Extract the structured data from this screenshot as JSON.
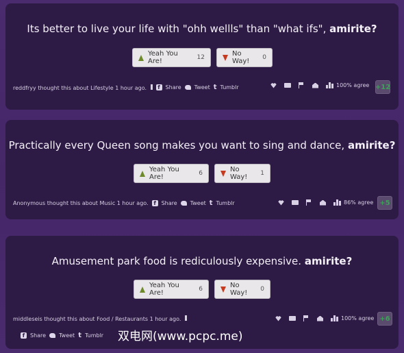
{
  "posts": [
    {
      "question": "Its better to live your life with \"ohh wellls\" than \"what ifs\",",
      "amirite": "amirite?",
      "yes_label": "Yeah You Are!",
      "yes_count": "12",
      "no_label": "No Way!",
      "no_count": "0",
      "author": "reddfryy",
      "meta_text": "thought this about Lifestyle 1 hour ago.",
      "share": "Share",
      "tweet": "Tweet",
      "tumblr": "Tumblr",
      "agree": "100% agree",
      "score": "+12"
    },
    {
      "question": "Practically every Queen song makes you want to sing and dance,",
      "amirite": "amirite?",
      "yes_label": "Yeah You Are!",
      "yes_count": "6",
      "no_label": "No Way!",
      "no_count": "1",
      "author": "Anonymous",
      "meta_text": "thought this about Music 1 hour ago.",
      "share": "Share",
      "tweet": "Tweet",
      "tumblr": "Tumblr",
      "agree": "86% agree",
      "score": "+5"
    },
    {
      "question": "Amusement park food is rediculously expensive.",
      "amirite": "amirite?",
      "yes_label": "Yeah You Are!",
      "yes_count": "6",
      "no_label": "No Way!",
      "no_count": "0",
      "author": "middleseis",
      "meta_text": "thought this about Food / Restaurants 1 hour ago.",
      "share": "Share",
      "tweet": "Tweet",
      "tumblr": "Tumblr",
      "agree": "100% agree",
      "score": "+6"
    }
  ],
  "watermark": "双电网(www.pcpc.me)",
  "colors": {
    "background": "#4a2b6e",
    "card": "#2d1a45",
    "score_green": "#3fa05a",
    "up_arrow": "#6e8a2a",
    "down_arrow": "#c63a1f"
  }
}
